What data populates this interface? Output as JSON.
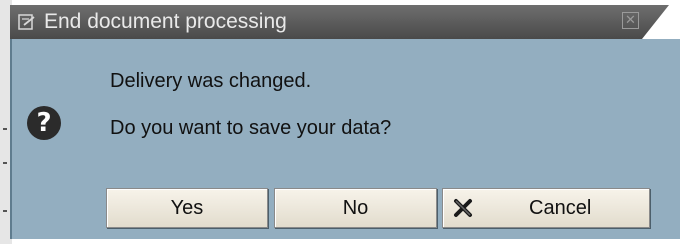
{
  "dialog": {
    "title": "End document processing",
    "message_line1": "Delivery was changed.",
    "message_line2": "Do you want to save your data?",
    "icons": {
      "title": "edit-document-icon",
      "close": "close-icon",
      "message": "question-icon",
      "cancel": "cancel-x-icon"
    },
    "buttons": {
      "yes": "Yes",
      "no": "No",
      "cancel": "Cancel"
    }
  },
  "colors": {
    "titlebar": "#5a5a5a",
    "body": "#93aec0",
    "button": "#ece7da"
  }
}
